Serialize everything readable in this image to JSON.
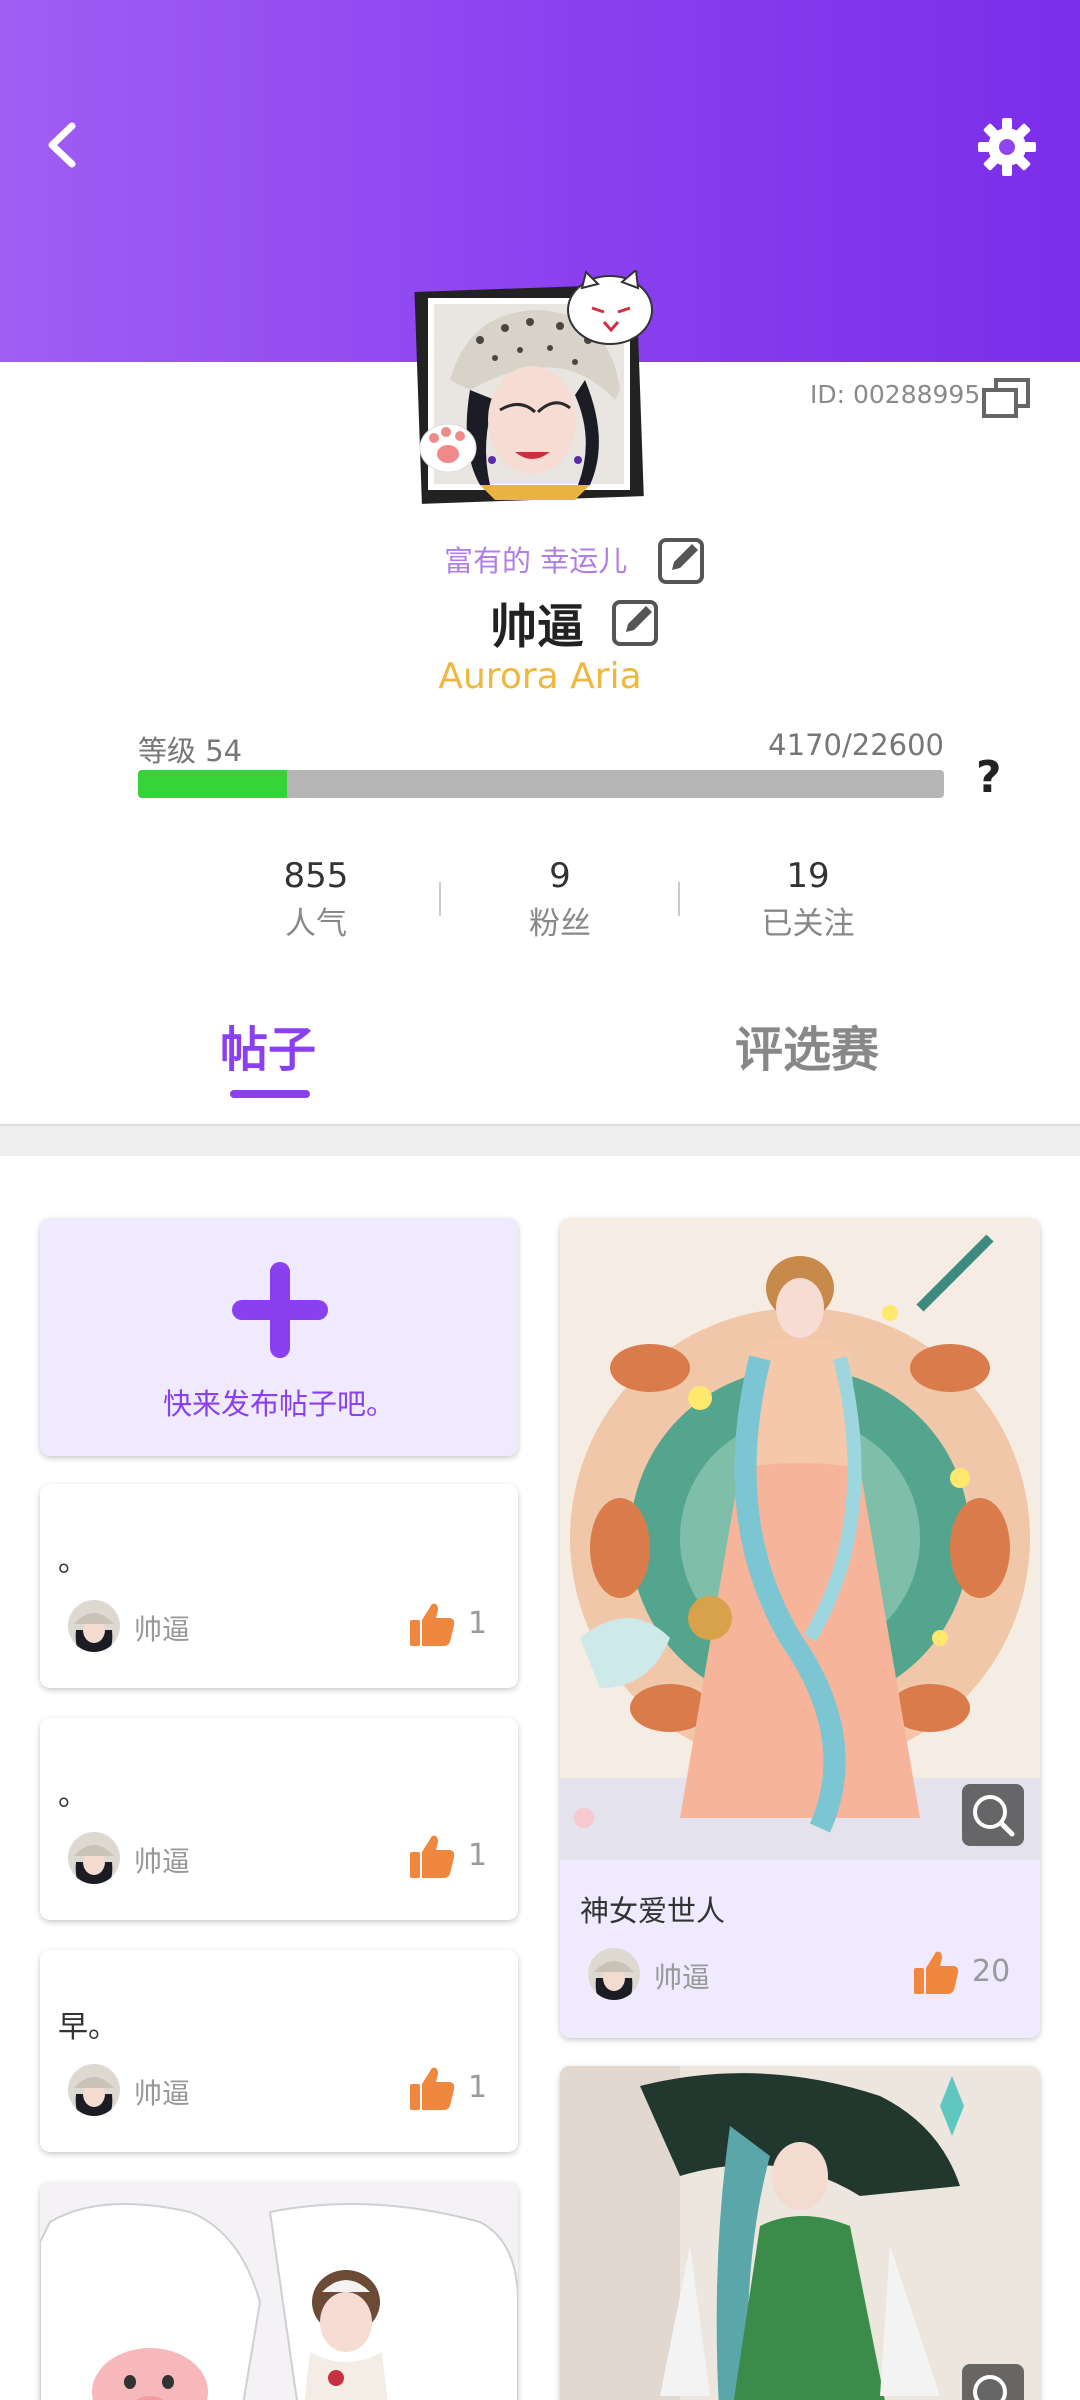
{
  "header": {
    "back_icon": "chevron-left-icon",
    "settings_icon": "gear-icon"
  },
  "profile": {
    "id_text": "ID: 00288995",
    "titles": "富有的 幸运儿",
    "nickname": "帅逼",
    "subtitle": "Aurora Aria",
    "level_label": "等级 54",
    "xp_text": "4170/22600",
    "xp_current": 4170,
    "xp_total": 22600,
    "help": "?"
  },
  "stats": [
    {
      "value": "855",
      "label": "人气"
    },
    {
      "value": "9",
      "label": "粉丝"
    },
    {
      "value": "19",
      "label": "已关注"
    }
  ],
  "tabs": [
    {
      "label": "帖子",
      "active": true
    },
    {
      "label": "评选赛",
      "active": false
    }
  ],
  "feed": {
    "new_post_label": "快来发布帖子吧。",
    "text_posts": [
      {
        "text": "。",
        "author": "帅逼",
        "likes": "1"
      },
      {
        "text": "。",
        "author": "帅逼",
        "likes": "1"
      },
      {
        "text": "早。",
        "author": "帅逼",
        "likes": "1"
      }
    ],
    "featured_post": {
      "title": "神女爱世人",
      "author": "帅逼",
      "likes": "20"
    }
  },
  "colors": {
    "accent": "#8a3ff0",
    "progress_fill": "#37d33a",
    "gold": "#f0b73e",
    "like_orange": "#f0873e"
  }
}
